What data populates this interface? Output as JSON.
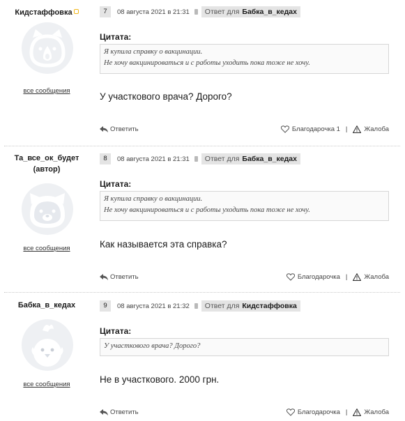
{
  "posts": [
    {
      "author": "Кидстаффовка",
      "online_badge": true,
      "all_messages": "все сообщения",
      "number": "7",
      "date": "08 августа 2021 в 21:31",
      "reply_to_label": "Ответ для",
      "reply_to_user": "Бабка_в_кедах",
      "quote_title": "Цитата:",
      "quote_lines": [
        "Я купила справку о вакцинации.",
        "Не хочу вакцинироваться и с работы уходить пока тоже не хочу."
      ],
      "text": "У участкового врача? Дорого?",
      "reply_label": "Ответить",
      "thanks_label": "Благодарочка 1",
      "complain_label": "Жалоба",
      "avatar_icon": "cat-avatar-icon"
    },
    {
      "author": "Та_все_ок_будет",
      "author_suffix": "(автор)",
      "all_messages": "все сообщения",
      "number": "8",
      "date": "08 августа 2021 в 21:31",
      "reply_to_label": "Ответ для",
      "reply_to_user": "Бабка_в_кедах",
      "quote_title": "Цитата:",
      "quote_lines": [
        "Я купила справку о вакцинации.",
        "Не хочу вакцинироваться и с работы уходить пока тоже не хочу."
      ],
      "text": "Как называется эта справка?",
      "reply_label": "Ответить",
      "thanks_label": "Благодарочка",
      "complain_label": "Жалоба",
      "avatar_icon": "bear-avatar-icon"
    },
    {
      "author": "Бабка_в_кедах",
      "all_messages": "все сообщения",
      "number": "9",
      "date": "08 августа 2021 в 21:32",
      "reply_to_label": "Ответ для",
      "reply_to_user": "Кидстаффовка",
      "quote_title": "Цитата:",
      "quote_lines": [
        "У участкового врача? Дорого?"
      ],
      "text": "Не в участкового. 2000 грн.",
      "reply_label": "Ответить",
      "thanks_label": "Благодарочка",
      "complain_label": "Жалоба",
      "avatar_icon": "chick-avatar-icon"
    }
  ],
  "colors": {
    "meta_bg": "#e4e4e4",
    "avatar_bg": "#eef0f3",
    "avatar_line": "#ffffff",
    "online_badge": "#f2b718"
  }
}
